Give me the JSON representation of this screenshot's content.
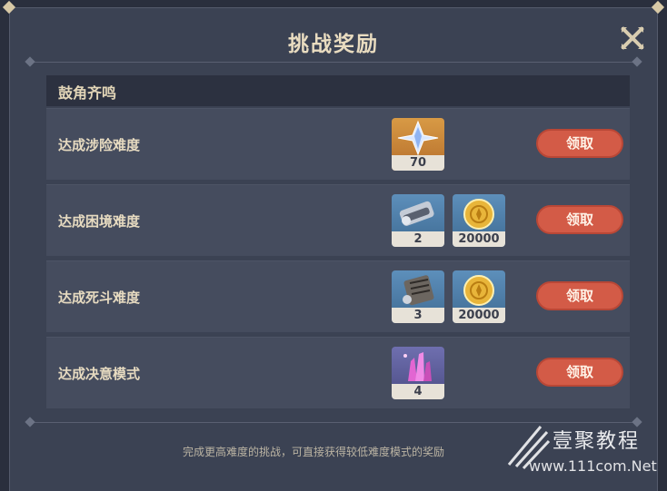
{
  "dialog": {
    "title": "挑战奖励",
    "section_title": "鼓角齐鸣",
    "rows": [
      {
        "label": "达成涉险难度",
        "rewards": [
          {
            "icon": "primogem-icon",
            "count": "70"
          }
        ],
        "button": "领取"
      },
      {
        "label": "达成困境难度",
        "rewards": [
          {
            "icon": "talent-book-icon",
            "count": "2"
          },
          {
            "icon": "mora-coin-icon",
            "count": "20000"
          }
        ],
        "button": "领取"
      },
      {
        "label": "达成死斗难度",
        "rewards": [
          {
            "icon": "talent-book-icon",
            "count": "3"
          },
          {
            "icon": "mora-coin-icon",
            "count": "20000"
          }
        ],
        "button": "领取"
      },
      {
        "label": "达成决意模式",
        "rewards": [
          {
            "icon": "crystal-icon",
            "count": "4"
          }
        ],
        "button": "领取"
      }
    ],
    "footer": "完成更高难度的挑战，可直接获得较低难度模式的奖励"
  },
  "watermark": {
    "name": "壹聚教程",
    "url": "www.111com.Net"
  },
  "colors": {
    "panel": "#3b4253",
    "row": "#454c5e",
    "claim_button": "#d35b47",
    "title": "#e9dcc0"
  }
}
